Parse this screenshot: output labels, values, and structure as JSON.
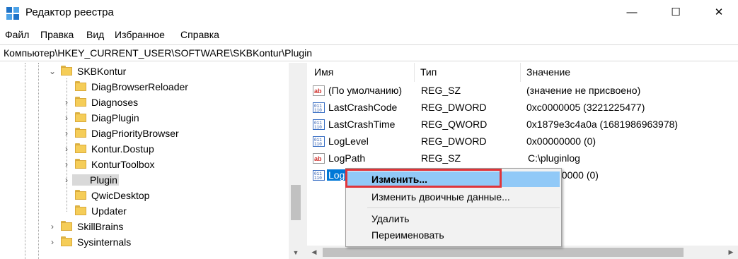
{
  "window": {
    "title": "Редактор реестра",
    "minimize_glyph": "—",
    "maximize_glyph": "☐",
    "close_glyph": "✕"
  },
  "menu": [
    "Файл",
    "Правка",
    "Вид",
    "Избранное",
    "Справка"
  ],
  "address": "Компьютер\\HKEY_CURRENT_USER\\SOFTWARE\\SKBKontur\\Plugin",
  "tree": {
    "parent": {
      "label": "SKBKontur",
      "expanded": true
    },
    "children": [
      {
        "label": "DiagBrowserReloader",
        "has_children": false
      },
      {
        "label": "Diagnoses",
        "has_children": true
      },
      {
        "label": "DiagPlugin",
        "has_children": true
      },
      {
        "label": "DiagPriorityBrowser",
        "has_children": true
      },
      {
        "label": "Kontur.Dostup",
        "has_children": true
      },
      {
        "label": "KonturToolbox",
        "has_children": true
      },
      {
        "label": "Plugin",
        "has_children": true,
        "selected": true
      },
      {
        "label": "QwicDesktop",
        "has_children": false
      },
      {
        "label": "Updater",
        "has_children": false
      }
    ],
    "siblings": [
      {
        "label": "SkillBrains",
        "has_children": true
      },
      {
        "label": "Sysinternals",
        "has_children": true
      }
    ]
  },
  "list": {
    "columns": [
      "Имя",
      "Тип",
      "Значение"
    ],
    "rows": [
      {
        "icon": "string-value-icon",
        "name": "(По умолчанию)",
        "type": "REG_SZ",
        "value": "(значение не присвоено)"
      },
      {
        "icon": "binary-value-icon",
        "name": "LastCrashCode",
        "type": "REG_DWORD",
        "value": "0xc0000005 (3221225477)"
      },
      {
        "icon": "binary-value-icon",
        "name": "LastCrashTime",
        "type": "REG_QWORD",
        "value": "0x1879e3c4a0a (1681986963978)"
      },
      {
        "icon": "binary-value-icon",
        "name": "LogLevel",
        "type": "REG_DWORD",
        "value": "0x00000000 (0)"
      },
      {
        "icon": "string-value-icon",
        "name": "LogPath",
        "type": "REG_SZ",
        "value": "C:\\pluginlog"
      },
      {
        "icon": "binary-value-icon",
        "name": "Log",
        "type": "",
        "value": "00000 (0)",
        "selected": true
      }
    ]
  },
  "context_menu": {
    "items": [
      {
        "label": "Изменить...",
        "highlighted": true
      },
      {
        "label": "Изменить двоичные данные..."
      },
      {
        "separator": true
      },
      {
        "label": "Удалить"
      },
      {
        "label": "Переименовать"
      }
    ]
  },
  "colors": {
    "selection": "#0078d7",
    "menu_highlight": "#91c9f7",
    "annotation_box": "#e0353a",
    "folder": "#f5cd58"
  }
}
